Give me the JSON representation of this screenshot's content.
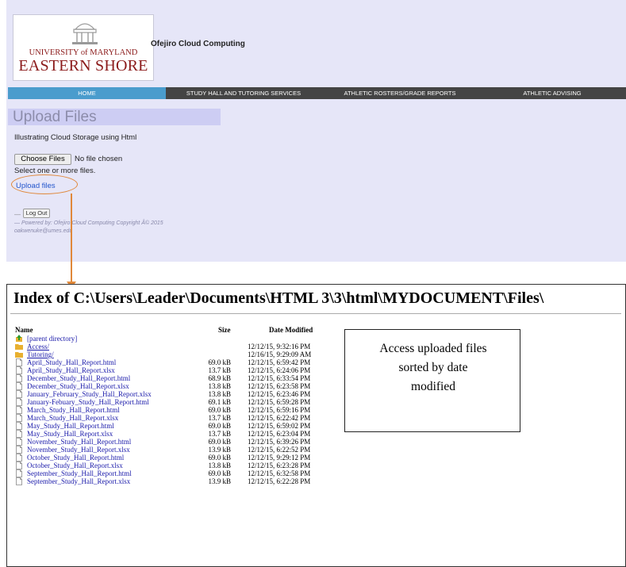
{
  "header": {
    "logo": {
      "line1": "UNIVERSITY of MARYLAND",
      "line2": "EASTERN SHORE"
    },
    "brand": "Ofejiro Cloud Computing"
  },
  "nav": {
    "items": [
      {
        "label": "HOME",
        "active": true
      },
      {
        "label": "STUDY HALL AND TUTORING SERVICES",
        "active": false
      },
      {
        "label": "ATHLETIC ROSTERS/GRADE REPORTS",
        "active": false
      },
      {
        "label": "ATHLETIC ADVISING",
        "active": false
      }
    ]
  },
  "upload": {
    "title": "Upload Files",
    "description": "Illustrating Cloud Storage using Html",
    "choose_label": "Choose Files",
    "no_file": "No file chosen",
    "hint": "Select one or more files.",
    "upload_link": "Upload files"
  },
  "footer": {
    "dash": "—",
    "logout": "Log Out",
    "powered": "— Powered by: Ofejiro Cloud Computing Copyright Â© 2015",
    "email": "oakwenuke@umes.edu"
  },
  "listing": {
    "title": "Index of C:\\Users\\Leader\\Documents\\HTML 3\\3\\html\\MYDOCUMENT\\Files\\",
    "columns": {
      "name": "Name",
      "size": "Size",
      "date": "Date Modified"
    },
    "rows": [
      {
        "name": "[parent directory]",
        "size": "",
        "date": "",
        "type": "parent"
      },
      {
        "name": "Access/",
        "size": "",
        "date": "12/12/15, 9:32:16 PM",
        "type": "folder"
      },
      {
        "name": "Tutoring/",
        "size": "",
        "date": "12/16/15, 9:29:09 AM",
        "type": "folder"
      },
      {
        "name": "April_Study_Hall_Report.html",
        "size": "69.0 kB",
        "date": "12/12/15, 6:59:42 PM",
        "type": "file"
      },
      {
        "name": "April_Study_Hall_Report.xlsx",
        "size": "13.7 kB",
        "date": "12/12/15, 6:24:06 PM",
        "type": "file"
      },
      {
        "name": "December_Study_Hall_Report.html",
        "size": "68.9 kB",
        "date": "12/12/15, 6:33:54 PM",
        "type": "file"
      },
      {
        "name": "December_Study_Hall_Report.xlsx",
        "size": "13.8 kB",
        "date": "12/12/15, 6:23:58 PM",
        "type": "file"
      },
      {
        "name": "January_February_Study_Hall_Report.xlsx",
        "size": "13.8 kB",
        "date": "12/12/15, 6:23:46 PM",
        "type": "file"
      },
      {
        "name": "January-Febuary_Study_Hall_Report.html",
        "size": "69.1 kB",
        "date": "12/12/15, 6:59:28 PM",
        "type": "file"
      },
      {
        "name": "March_Study_Hall_Report.html",
        "size": "69.0 kB",
        "date": "12/12/15, 6:59:16 PM",
        "type": "file"
      },
      {
        "name": "March_Study_Hall_Report.xlsx",
        "size": "13.7 kB",
        "date": "12/12/15, 6:22:42 PM",
        "type": "file"
      },
      {
        "name": "May_Study_Hall_Report.html",
        "size": "69.0 kB",
        "date": "12/12/15, 6:59:02 PM",
        "type": "file"
      },
      {
        "name": "May_Study_Hall_Report.xlsx",
        "size": "13.7 kB",
        "date": "12/12/15, 6:23:04 PM",
        "type": "file"
      },
      {
        "name": "November_Study_Hall_Report.html",
        "size": "69.0 kB",
        "date": "12/12/15, 6:39:26 PM",
        "type": "file"
      },
      {
        "name": "November_Study_Hall_Report.xlsx",
        "size": "13.9 kB",
        "date": "12/12/15, 6:22:52 PM",
        "type": "file"
      },
      {
        "name": "October_Study_Hall_Report.html",
        "size": "69.0 kB",
        "date": "12/12/15, 9:29:12 PM",
        "type": "file"
      },
      {
        "name": "October_Study_Hall_Report.xlsx",
        "size": "13.8 kB",
        "date": "12/12/15, 6:23:28 PM",
        "type": "file"
      },
      {
        "name": "September_Study_Hall_Report.html",
        "size": "69.0 kB",
        "date": "12/12/15, 6:32:58 PM",
        "type": "file"
      },
      {
        "name": "September_Study_Hall_Report.xlsx",
        "size": "13.9 kB",
        "date": "12/12/15, 6:22:28 PM",
        "type": "file"
      }
    ]
  },
  "annotation": {
    "lines": [
      "Access uploaded files",
      "sorted by date",
      "modified"
    ]
  },
  "colors": {
    "panel_bg": "#e6e6f8",
    "nav_bg": "#444444",
    "nav_active": "#4a9ccd",
    "logo_red": "#8b1a1a",
    "link_blue": "#1a1aaa",
    "callout_orange": "#e0883a"
  }
}
